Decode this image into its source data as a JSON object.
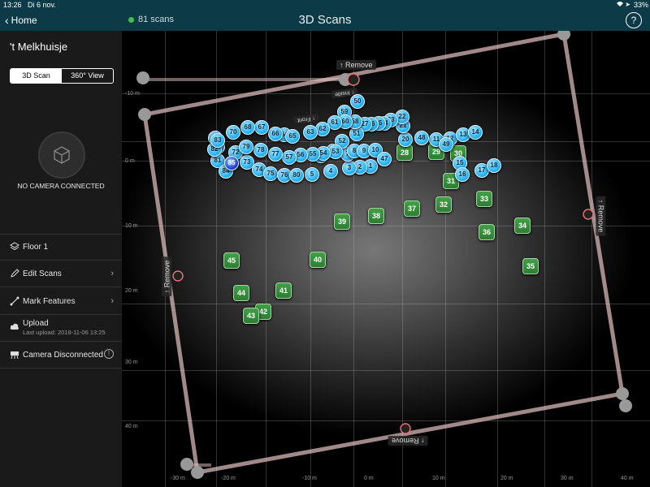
{
  "status": {
    "time": "13:26",
    "date": "Di 6 nov.",
    "battery": "33%"
  },
  "nav": {
    "back_label": "Home",
    "scan_count": "81 scans",
    "title": "3D Scans",
    "help_label": "?"
  },
  "sidebar": {
    "project_name": "'t Melkhuisje",
    "view_toggle": {
      "scan_label": "3D Scan",
      "view360_label": "360° View"
    },
    "camera_status": "NO CAMERA CONNECTED",
    "floor_label": "Floor 1",
    "edit_scans_label": "Edit Scans",
    "mark_features_label": "Mark Features",
    "upload_label": "Upload",
    "last_upload": "Last upload: 2018-11-06 13:25",
    "camera_disconnected_label": "Camera Disconnected"
  },
  "map": {
    "remove_label": "Remove",
    "front_label": "Front",
    "inside_label": "Inside",
    "y_labels": [
      "-10 m",
      "0 m",
      "10 m",
      "20 m",
      "30 m",
      "40 m"
    ],
    "x_labels": [
      "-30 m",
      "-20 m",
      "-10 m",
      "0 m",
      "10 m",
      "20 m",
      "30 m",
      "40 m"
    ],
    "green_markers": [
      "28",
      "29",
      "30",
      "31",
      "32",
      "33",
      "34",
      "35",
      "36",
      "37",
      "38",
      "39",
      "40",
      "41",
      "42",
      "43",
      "44",
      "45"
    ],
    "blue_markers": [
      "1",
      "2",
      "3",
      "4",
      "5",
      "6",
      "7",
      "8",
      "9",
      "10",
      "11",
      "12",
      "13",
      "14",
      "15",
      "16",
      "17",
      "18",
      "20",
      "21",
      "22",
      "23",
      "24",
      "25",
      "26",
      "27",
      "46",
      "47",
      "48",
      "49",
      "50",
      "51",
      "52",
      "53",
      "54",
      "55",
      "56",
      "57",
      "58",
      "59",
      "60",
      "61",
      "62",
      "63",
      "64",
      "65",
      "66",
      "67",
      "68",
      "69",
      "70",
      "71",
      "72",
      "73",
      "74",
      "75",
      "76",
      "77",
      "78",
      "79",
      "80",
      "81",
      "82",
      "83",
      "84",
      "85"
    ],
    "selected_marker": "85",
    "colors": {
      "navbar": "#0c3b47",
      "green_marker": "#2e7d32",
      "blue_marker": "#29b6f6",
      "selected_marker": "#1e40d8",
      "boundary": "#e6c3c3"
    }
  }
}
